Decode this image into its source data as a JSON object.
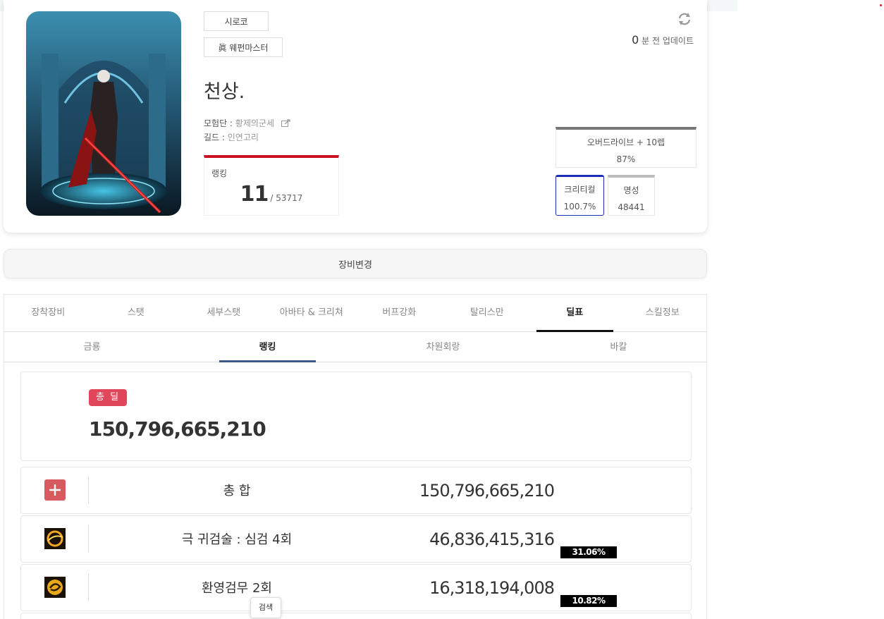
{
  "header": {
    "update_num": "0",
    "update_text": "분 전 업데이트"
  },
  "profile": {
    "server": "시로코",
    "job": "眞 웨펀마스터",
    "name": "천상.",
    "adventure_label": "모험단 : ",
    "adventure_value": "황제의군세",
    "guild_label": "길드 : ",
    "guild_value": "인연고리",
    "ranking_label": "랭킹",
    "ranking_value": "11",
    "ranking_total": "/ 53717"
  },
  "stats": {
    "overdrive_label": "오버드라이브 + 10렙",
    "overdrive_value": "87%",
    "critical_label": "크리티컬",
    "critical_value": "100.7%",
    "fame_label": "명성",
    "fame_value": "48441"
  },
  "equip_change_label": "장비변경",
  "tabs": [
    "장착장비",
    "스탯",
    "세부스탯",
    "아바타 & 크리쳐",
    "버프강화",
    "탈리스만",
    "딜표",
    "스킬정보"
  ],
  "active_tab": 6,
  "subtabs": [
    "금룡",
    "랭킹",
    "차원회랑",
    "바칼"
  ],
  "active_subtab": 1,
  "total": {
    "badge": "총 딜",
    "value": "150,796,665,210"
  },
  "rows": [
    {
      "name": "총 합",
      "amount": "150,796,665,210",
      "pct": "",
      "icon": "plus-icon"
    },
    {
      "name": "극 귀검술 : 심검 4회",
      "amount": "46,836,415,316",
      "pct": "31.06%",
      "icon": "skill-sword-icon"
    },
    {
      "name": "환영검무 2회",
      "amount": "16,318,194,008",
      "pct": "10.82%",
      "icon": "skill-dance-icon"
    }
  ],
  "search_tip": "검색",
  "colors": {
    "accent_red": "#cc1122",
    "badge_red": "#e0475a",
    "crit_blue": "#1a2fb5",
    "subtab_blue": "#3a5a8a"
  }
}
